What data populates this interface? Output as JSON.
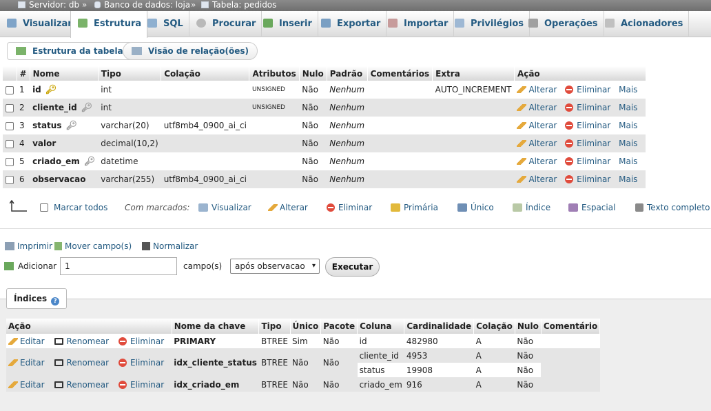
{
  "breadcrumb": {
    "server": "Servidor: db",
    "database": "Banco de dados: loja",
    "table": "Tabela: pedidos",
    "separator": "»"
  },
  "tabs": [
    {
      "label": "Visualizar",
      "icon": "table-browse-icon"
    },
    {
      "label": "Estrutura",
      "icon": "structure-icon",
      "active": true
    },
    {
      "label": "SQL",
      "icon": "sql-icon"
    },
    {
      "label": "Procurar",
      "icon": "search-icon"
    },
    {
      "label": "Inserir",
      "icon": "insert-icon"
    },
    {
      "label": "Exportar",
      "icon": "export-icon"
    },
    {
      "label": "Importar",
      "icon": "import-icon"
    },
    {
      "label": "Privilégios",
      "icon": "privileges-icon"
    },
    {
      "label": "Operações",
      "icon": "wrench-icon"
    },
    {
      "label": "Acionadores",
      "icon": "triggers-icon"
    }
  ],
  "subtabs": {
    "structure": "Estrutura da tabela",
    "relations": "Visão de relação(ões)"
  },
  "columns_table": {
    "headers": [
      "#",
      "Nome",
      "Tipo",
      "Colação",
      "Atributos",
      "Nulo",
      "Padrão",
      "Comentários",
      "Extra",
      "Ação"
    ],
    "rows": [
      {
        "num": "1",
        "name": "id",
        "key": "primary",
        "type": "int",
        "collation": "",
        "attributes": "UNSIGNED",
        "null": "Não",
        "default": "Nenhum",
        "comments": "",
        "extra": "AUTO_INCREMENT"
      },
      {
        "num": "2",
        "name": "cliente_id",
        "key": "index",
        "type": "int",
        "collation": "",
        "attributes": "UNSIGNED",
        "null": "Não",
        "default": "Nenhum",
        "comments": "",
        "extra": ""
      },
      {
        "num": "3",
        "name": "status",
        "key": "index",
        "type": "varchar(20)",
        "collation": "utf8mb4_0900_ai_ci",
        "attributes": "",
        "null": "Não",
        "default": "Nenhum",
        "comments": "",
        "extra": ""
      },
      {
        "num": "4",
        "name": "valor",
        "key": "",
        "type": "decimal(10,2)",
        "collation": "",
        "attributes": "",
        "null": "Não",
        "default": "Nenhum",
        "comments": "",
        "extra": ""
      },
      {
        "num": "5",
        "name": "criado_em",
        "key": "index",
        "type": "datetime",
        "collation": "",
        "attributes": "",
        "null": "Não",
        "default": "Nenhum",
        "comments": "",
        "extra": ""
      },
      {
        "num": "6",
        "name": "observacao",
        "key": "",
        "type": "varchar(255)",
        "collation": "utf8mb4_0900_ai_ci",
        "attributes": "",
        "null": "Não",
        "default": "Nenhum",
        "comments": "",
        "extra": ""
      }
    ],
    "actions": {
      "change": "Alterar",
      "drop": "Eliminar",
      "more": "Mais"
    }
  },
  "bulk": {
    "check_all": "Marcar todos",
    "with_selected": "Com marcados:",
    "browse": "Visualizar",
    "change": "Alterar",
    "drop": "Eliminar",
    "primary": "Primária",
    "unique": "Único",
    "index": "Índice",
    "spatial": "Espacial",
    "fulltext": "Texto completo"
  },
  "tools": {
    "print": "Imprimir",
    "move_columns": "Mover campo(s)",
    "normalize": "Normalizar"
  },
  "add_columns": {
    "label": "Adicionar",
    "count": "1",
    "unit": "campo(s)",
    "position": "após observacao",
    "submit": "Executar"
  },
  "indexes": {
    "title": "Índices",
    "headers": [
      "Ação",
      "Nome da chave",
      "Tipo",
      "Único",
      "Pacote",
      "Coluna",
      "Cardinalidade",
      "Colação",
      "Nulo",
      "Comentário"
    ],
    "actions": {
      "edit": "Editar",
      "rename": "Renomear",
      "drop": "Eliminar"
    },
    "rows": [
      {
        "key_name": "PRIMARY",
        "type": "BTREE",
        "unique": "Sim",
        "packed": "Não",
        "columns": [
          {
            "column": "id",
            "cardinality": "482980",
            "collation": "A",
            "null": "Não"
          }
        ]
      },
      {
        "key_name": "idx_cliente_status",
        "type": "BTREE",
        "unique": "Não",
        "packed": "Não",
        "columns": [
          {
            "column": "cliente_id",
            "cardinality": "4953",
            "collation": "A",
            "null": "Não"
          },
          {
            "column": "status",
            "cardinality": "19908",
            "collation": "A",
            "null": "Não"
          }
        ]
      },
      {
        "key_name": "idx_criado_em",
        "type": "BTREE",
        "unique": "Não",
        "packed": "Não",
        "columns": [
          {
            "column": "criado_em",
            "cardinality": "916",
            "collation": "A",
            "null": "Não"
          }
        ]
      }
    ]
  },
  "colors": {
    "link": "#235a81",
    "row_alt": "#e5e5e5",
    "drop_icon": "#e04b3c",
    "primary_key": "#c9a300"
  }
}
